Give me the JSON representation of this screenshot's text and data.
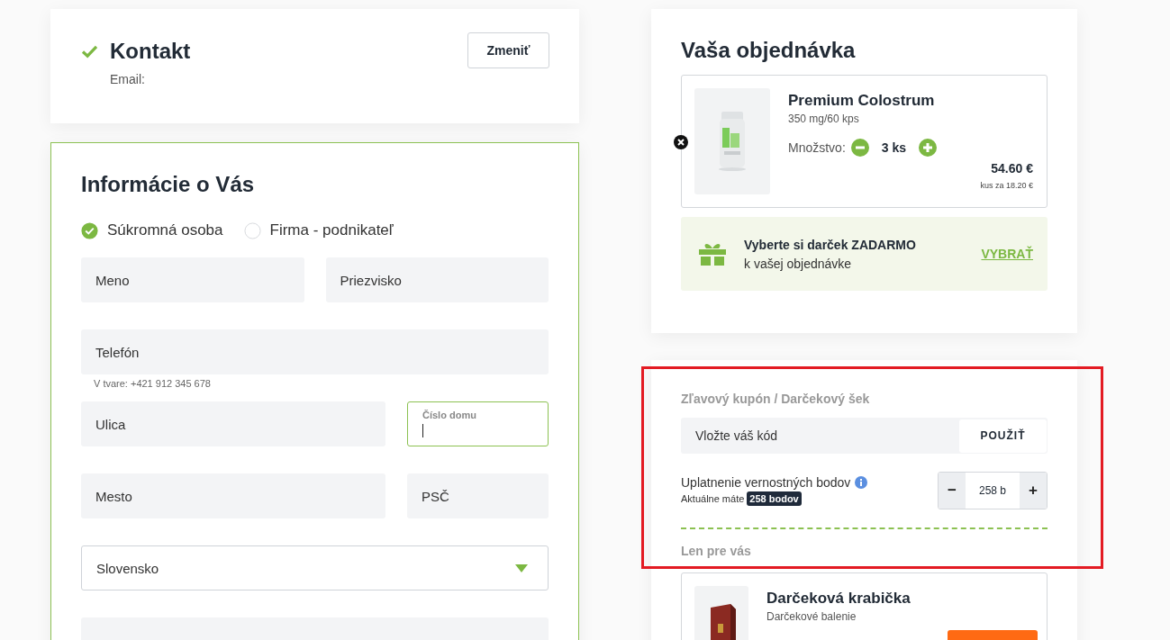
{
  "contact": {
    "title": "Kontakt",
    "completed": true,
    "email_label": "Email:",
    "change_button": "Zmeniť"
  },
  "info": {
    "title": "Informácie o Vás",
    "customer_types": [
      {
        "label": "Súkromná osoba",
        "selected": true
      },
      {
        "label": "Firma - podnikateľ",
        "selected": false
      }
    ],
    "rows": [
      {
        "kind": "pair",
        "fields": [
          {
            "kind": "text",
            "placeholder": "Meno"
          },
          {
            "kind": "text",
            "placeholder": "Priezvisko"
          }
        ]
      },
      {
        "kind": "single",
        "fields": [
          {
            "kind": "text",
            "placeholder": "Telefón",
            "hint": "V tvare: +421 912 345 678"
          }
        ]
      },
      {
        "kind": "address",
        "fields": [
          {
            "kind": "text",
            "placeholder": "Ulica"
          },
          {
            "kind": "floating",
            "label": "Číslo domu",
            "focused": true
          }
        ]
      },
      {
        "kind": "address",
        "fields": [
          {
            "kind": "text",
            "placeholder": "Mesto"
          },
          {
            "kind": "text",
            "placeholder": "PSČ"
          }
        ]
      },
      {
        "kind": "single",
        "fields": [
          {
            "kind": "select",
            "value": "Slovensko"
          }
        ]
      },
      {
        "kind": "single",
        "fields": [
          {
            "kind": "blank"
          }
        ]
      }
    ]
  },
  "order": {
    "title": "Vaša objednávka",
    "items": [
      {
        "name": "Premium Colostrum",
        "variant": "350 mg/60 kps",
        "quantity_label": "Množstvo:",
        "quantity": "3 ks",
        "price": "54.60 €",
        "unit_price": "kus za 18.20 €"
      }
    ],
    "gift_offer": {
      "title": "Vyberte si darček ZADARMO",
      "subtitle": "k vašej objednávke",
      "action": "VYBRAŤ"
    }
  },
  "discounts": {
    "coupon_label": "Zľavový kupón / Darčekový šek",
    "coupon_placeholder": "Vložte váš kód",
    "apply_button": "POUŽIŤ",
    "loyalty": {
      "title": "Uplatnenie vernostných bodov",
      "current_prefix": "Aktuálne máte",
      "points_badge": "258 bodov",
      "minus": "−",
      "value": "258 b",
      "plus": "+"
    },
    "section_title": "Len pre vás",
    "offers": [
      {
        "name": "Darčeková krabička",
        "subtitle": "Darčekové balenie"
      }
    ]
  },
  "annotations": [
    {
      "kind": "frame"
    }
  ]
}
